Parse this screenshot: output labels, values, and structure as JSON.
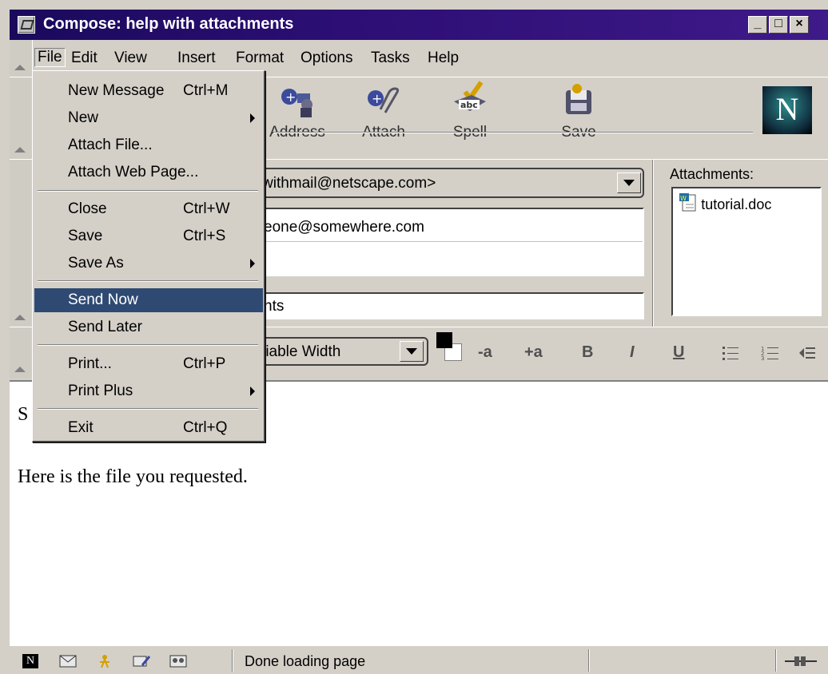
{
  "window": {
    "title": "Compose: help with attachments",
    "controls": [
      "_",
      "□",
      "×"
    ]
  },
  "menubar": [
    {
      "label": "File"
    },
    {
      "label": "Edit"
    },
    {
      "label": "View"
    },
    {
      "label": "Insert"
    },
    {
      "label": "Format"
    },
    {
      "label": "Options"
    },
    {
      "label": "Tasks"
    },
    {
      "label": "Help"
    }
  ],
  "toolbar": [
    {
      "label": "Address",
      "icon": "address-book-icon"
    },
    {
      "label": "Attach",
      "icon": "paperclip-icon"
    },
    {
      "label": "Spell",
      "icon": "spellcheck-icon"
    },
    {
      "label": "Save",
      "icon": "save-icon"
    }
  ],
  "logo": {
    "text": "N"
  },
  "address": {
    "from_visible": "withmail@netscape.com>",
    "to_visible": "eone@somewhere.com",
    "subject_visible": "nts",
    "attachments_label": "Attachments:",
    "attachments": [
      "tutorial.doc"
    ]
  },
  "format": {
    "font_visible": "riable Width",
    "buttons": [
      "-a",
      "+a",
      "B",
      "I",
      "U"
    ]
  },
  "message_body": {
    "line1_visible": "S",
    "line2": "Here is the file you requested."
  },
  "status": {
    "text": "Done loading page"
  },
  "file_menu": {
    "items": [
      {
        "label": "New Message",
        "shortcut": "Ctrl+M",
        "submenu": false
      },
      {
        "label": "New",
        "shortcut": "",
        "submenu": true
      },
      {
        "label": "Attach File...",
        "shortcut": "",
        "submenu": false
      },
      {
        "label": "Attach Web Page...",
        "shortcut": "",
        "submenu": false
      },
      {
        "label": "Close",
        "shortcut": "Ctrl+W",
        "submenu": false
      },
      {
        "label": "Save",
        "shortcut": "Ctrl+S",
        "submenu": false
      },
      {
        "label": "Save As",
        "shortcut": "",
        "submenu": true
      },
      {
        "label": "Send Now",
        "shortcut": "",
        "submenu": false,
        "highlighted": true
      },
      {
        "label": "Send Later",
        "shortcut": "",
        "submenu": false
      },
      {
        "label": "Print...",
        "shortcut": "Ctrl+P",
        "submenu": false
      },
      {
        "label": "Print Plus",
        "shortcut": "",
        "submenu": true
      },
      {
        "label": "Exit",
        "shortcut": "Ctrl+Q",
        "submenu": false
      }
    ]
  },
  "colors": {
    "titlebar": "#2c0e74",
    "highlight": "#2f4a72",
    "chrome": "#d4d0c8"
  }
}
